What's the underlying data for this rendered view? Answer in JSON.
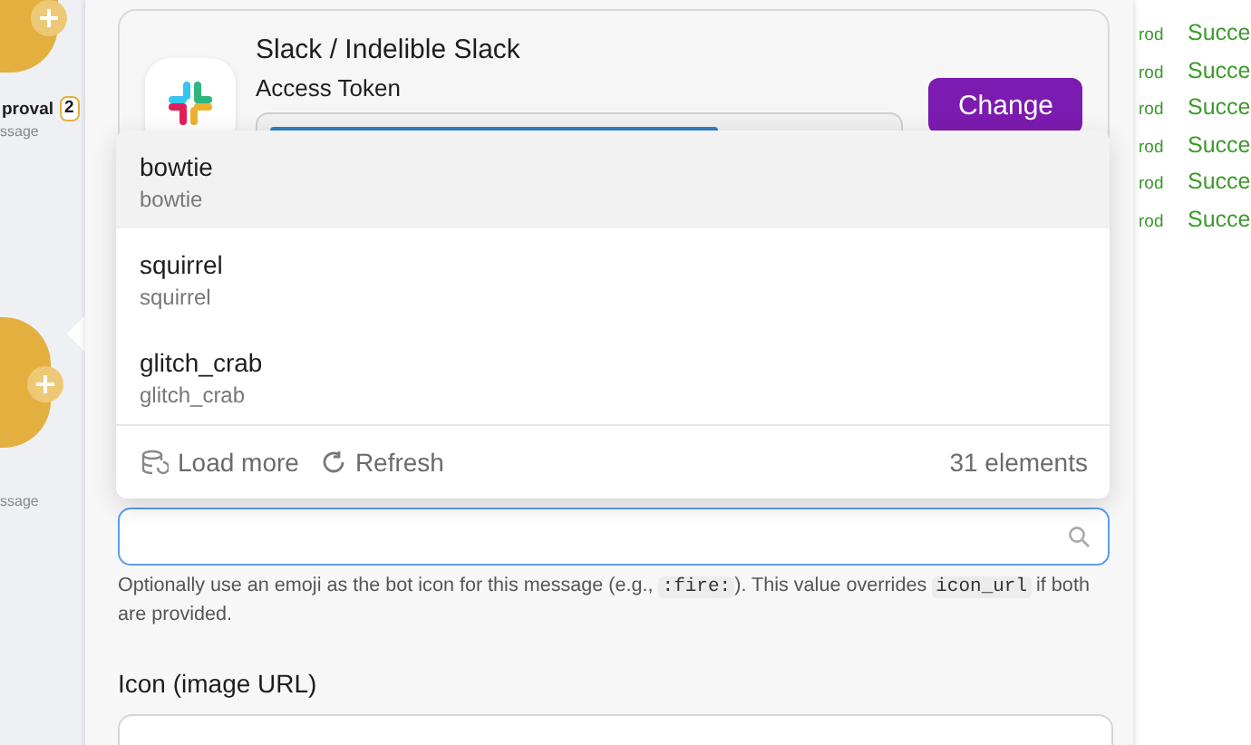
{
  "canvas_nodes": [
    {
      "title": "proval",
      "badge": "2",
      "subtitle": "ssage"
    },
    {
      "subtitle": "ssage"
    }
  ],
  "connection": {
    "title": "Slack / Indelible Slack",
    "subtitle": "Access Token",
    "button": "Change"
  },
  "dropdown": {
    "options": [
      {
        "label": "bowtie",
        "value": "bowtie",
        "selected": true
      },
      {
        "label": "squirrel",
        "value": "squirrel",
        "selected": false
      },
      {
        "label": "glitch_crab",
        "value": "glitch_crab",
        "selected": false
      }
    ],
    "load_more": "Load more",
    "refresh": "Refresh",
    "count": "31 elements"
  },
  "help": [
    {
      "kind": "text",
      "text": "Optionally use an emoji as the bot icon for this message (e.g., "
    },
    {
      "kind": "code",
      "text": ":fire:"
    },
    {
      "kind": "text",
      "text": "). This value overrides "
    },
    {
      "kind": "code",
      "text": "icon_url"
    },
    {
      "kind": "text",
      "text": " if both are provided."
    }
  ],
  "icon_field": {
    "label": "Icon (image URL)"
  },
  "runs": [
    {
      "env": "rod",
      "status": "Succe"
    },
    {
      "env": "rod",
      "status": "Succe"
    },
    {
      "env": "rod",
      "status": "Succe"
    },
    {
      "env": "rod",
      "status": "Succe"
    },
    {
      "env": "rod",
      "status": "Succe"
    },
    {
      "env": "rod",
      "status": "Succe"
    }
  ]
}
